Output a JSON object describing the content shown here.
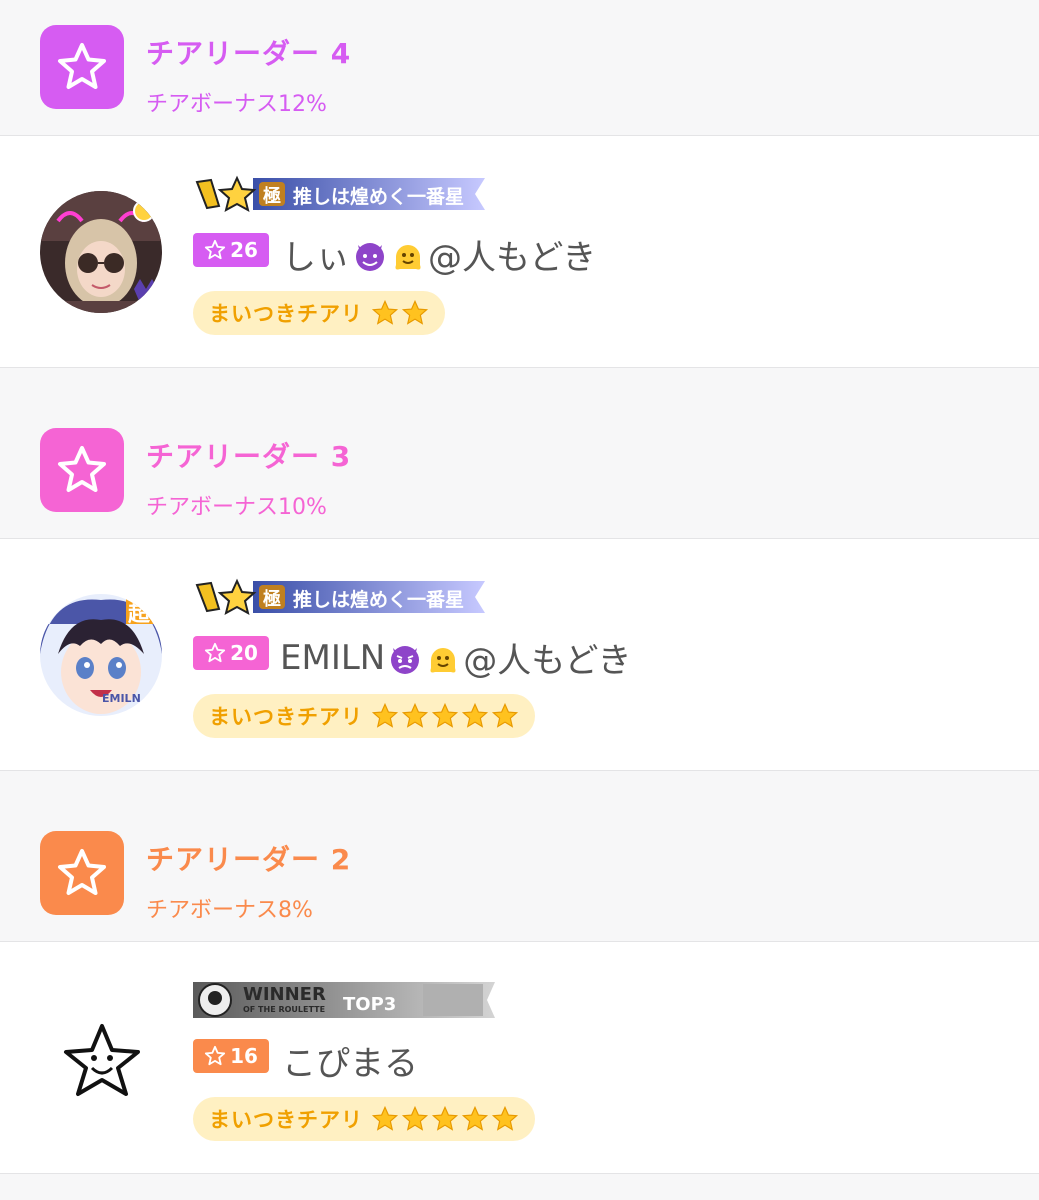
{
  "tiers": [
    {
      "title": "チアリーダー 4",
      "bonus": "チアボーナス12%",
      "color": "#d65cf2",
      "entry": {
        "banner_text": "推しは煌めく一番星",
        "banner_mark": "極",
        "level": "26",
        "name": "しぃ",
        "name_suffix": "@人もどき",
        "cheer_label": "まいつきチアリ",
        "cheer_stars": 2
      }
    },
    {
      "title": "チアリーダー 3",
      "bonus": "チアボーナス10%",
      "color": "#f564d4",
      "entry": {
        "banner_text": "推しは煌めく一番星",
        "banner_mark": "極",
        "level": "20",
        "name": "EMILN",
        "name_suffix": "@人もどき",
        "avatar_badge": "超",
        "avatar_caption": "EMILN",
        "cheer_label": "まいつきチアリ",
        "cheer_stars": 5
      }
    },
    {
      "title": "チアリーダー 2",
      "bonus": "チアボーナス8%",
      "color": "#fa8a4c",
      "entry": {
        "banner_text": "WINNER",
        "banner_sub": "OF THE ROULETTE",
        "banner_top": "TOP3",
        "level": "16",
        "name": "こぴまる",
        "cheer_label": "まいつきチアリ",
        "cheer_stars": 5
      }
    }
  ],
  "colors": {
    "cheer_pill_bg": "#fff0c2",
    "cheer_text": "#f0a000",
    "star_fill": "#ffc21f",
    "header_bg": "#f7f7f8"
  }
}
